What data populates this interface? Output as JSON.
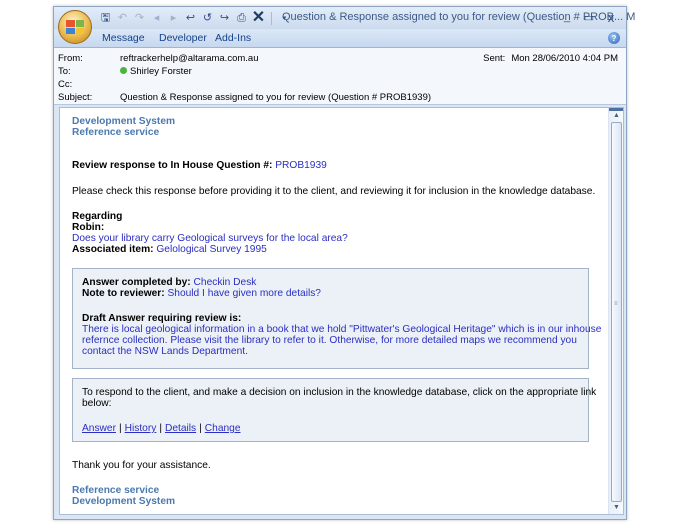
{
  "window": {
    "title": "Question & Response assigned to you for review (Question # PROB... M",
    "controls": [
      "_",
      "▭",
      "x"
    ]
  },
  "ribbon": {
    "tabs": [
      "Message",
      "Developer",
      "Add-Ins"
    ]
  },
  "headers": {
    "from_label": "From:",
    "from_value": "reftrackerhelp@altarama.com.au",
    "to_label": "To:",
    "to_value": "Shirley Forster",
    "cc_label": "Cc:",
    "cc_value": "",
    "subject_label": "Subject:",
    "subject_value": "Question & Response assigned to you for review (Question # PROB1939)",
    "sent_label": "Sent:",
    "sent_value": "Mon 28/06/2010 4:04 PM"
  },
  "message": {
    "system_line1": "Development System",
    "system_line2": "Reference service",
    "review_label": "Review response to In House Question #:",
    "question_id": "PROB1939",
    "instruction": "Please check this response before providing it to the client, and reviewing it for inclusion in the knowledge database.",
    "regarding_label": "Regarding",
    "client_name": "Robin:",
    "question_text": "Does your library carry Geological surveys for the local area?",
    "associated_label": "Associated item:",
    "associated_value": "Gelological Survey 1995",
    "answer_completed_label": "Answer completed by:",
    "answer_completed_value": "Checkin Desk",
    "note_label": "Note to reviewer:",
    "note_value": "Should I have given more details?",
    "draft_label": "Draft Answer requiring review is:",
    "draft_line1": "There is local geological information in a book that we hold \"Pittwater's Geological Heritage\" which is in our inhouse",
    "draft_line2": "refernce collection. Please visit the library to refer to it. Otherwise, for more detailed maps we recommend you",
    "draft_line3": "contact the NSW Lands Department.",
    "respond_line1": "To respond to the client, and make a decision on inclusion in the knowledge database, click on the appropriate link",
    "respond_line2": "below:",
    "links": [
      "Answer",
      "History",
      "Details",
      "Change"
    ],
    "thanks": "Thank you for your assistance.",
    "footer_line1": "Reference service",
    "footer_line2": "Development System"
  },
  "colors": {
    "system_name": "#4b79b0",
    "link_blue": "#2a2ec2",
    "box_bg": "#ecf1f7",
    "ribbon_text": "#15428b"
  }
}
